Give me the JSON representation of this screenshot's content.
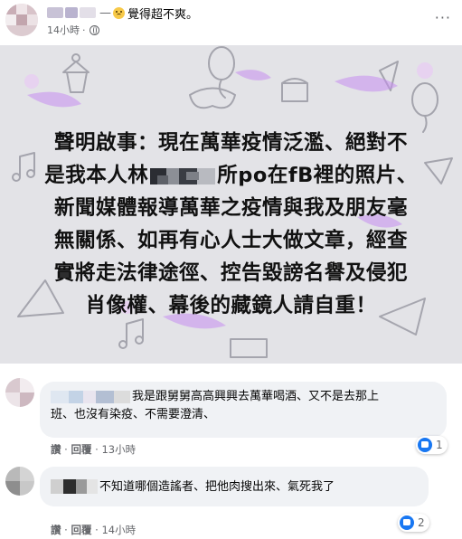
{
  "post": {
    "author_separator": "—",
    "feeling": "覺得超不爽。",
    "time": "14小時",
    "dot": "·",
    "more": "···"
  },
  "image_text": {
    "line1": "聲明啟事：現在萬華疫情泛濫、絕對不",
    "line2_a": "是我本人林",
    "line2_b": "所po在fB裡的照片、",
    "line3": "新聞媒體報導萬華之疫情與我及朋友毫",
    "line4": "無關係、如再有心人士大做文章，經查",
    "line5": "實將走法律途徑、控告毀謗名譽及侵犯",
    "line6": "肖像權、幕後的藏鏡人請自重！"
  },
  "comments": [
    {
      "text_line1": "我是跟舅舅高高興興去萬華喝酒、又不是去那上",
      "text_line2": "班、也沒有染疫、不需要澄清、",
      "like": "讚",
      "reply": "回覆",
      "time": "13小時",
      "reaction_count": "1"
    },
    {
      "text": "不知道哪個造謠者、把他肉搜出來、氣死我了",
      "like": "讚",
      "reply": "回覆",
      "time": "14小時",
      "reaction_count": "2"
    }
  ],
  "colors": {
    "like_blue": "#1877f2",
    "bubble": "#f0f2f5",
    "image_bg": "#e3e3e7",
    "secondary_text": "#65676b"
  }
}
